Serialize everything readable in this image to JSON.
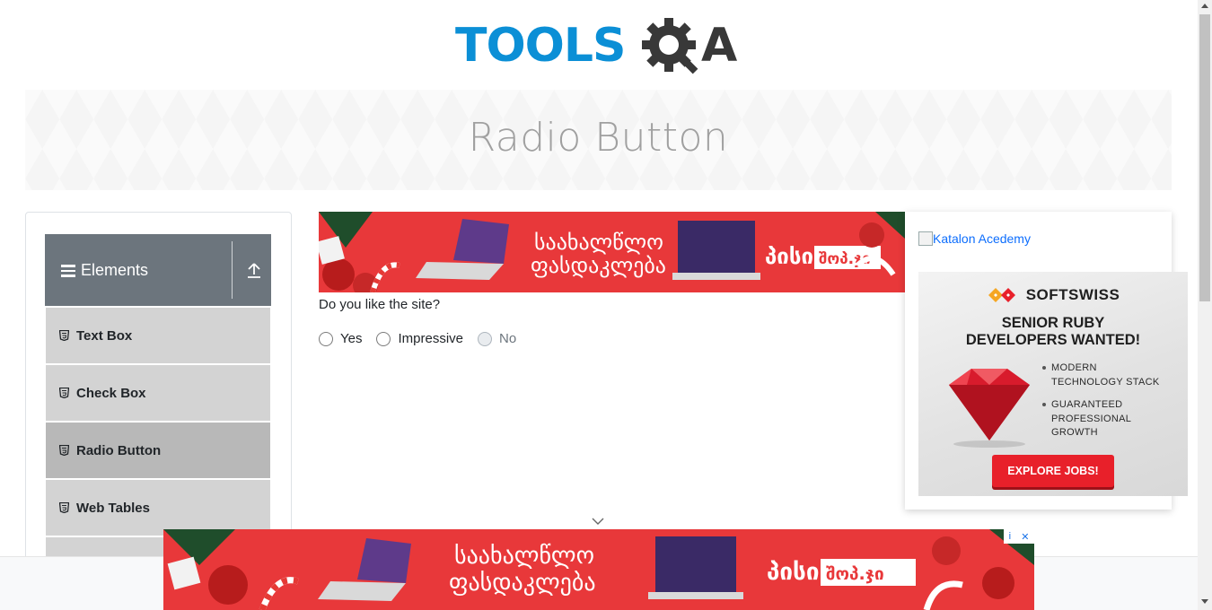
{
  "header": {
    "logo_text_tools": "TOOLS",
    "logo_text_a": "A",
    "logo_icon": "gear-magnifier-icon"
  },
  "banner": {
    "title": "Radio Button"
  },
  "sidebar": {
    "group_title": "Elements",
    "group_icon": "hamburger-icon",
    "collapse_icon": "upload-arrow-icon",
    "items": [
      {
        "label": "Text Box",
        "active": false
      },
      {
        "label": "Check Box",
        "active": false
      },
      {
        "label": "Radio Button",
        "active": true
      },
      {
        "label": "Web Tables",
        "active": false
      },
      {
        "label": "",
        "active": false
      }
    ]
  },
  "main": {
    "question": "Do you like the site?",
    "options": [
      {
        "label": "Yes",
        "disabled": false,
        "checked": false
      },
      {
        "label": "Impressive",
        "disabled": false,
        "checked": false
      },
      {
        "label": "No",
        "disabled": true,
        "checked": false
      }
    ]
  },
  "ads": {
    "top_banner": {
      "line1": "საახალწლო",
      "line2": "ფასდაკლება",
      "brand": "პისი",
      "brand_box": "შოპ.ჯი"
    },
    "bottom_banner": {
      "line1": "საახალწლო",
      "line2": "ფასდაკლება",
      "brand": "პისი",
      "brand_box": "შოპ.ჯი"
    },
    "katalon_alt": "Katalon Acedemy",
    "softswiss": {
      "brand": "SOFTSWISS",
      "headline_1": "SENIOR RUBY",
      "headline_2": "DEVELOPERS WANTED!",
      "bullet_1a": "MODERN",
      "bullet_1b": "TECHNOLOGY STACK",
      "bullet_2a": "GUARANTEED",
      "bullet_2b": "PROFESSIONAL",
      "bullet_2c": "GROWTH",
      "cta": "EXPLORE JOBS!"
    },
    "adchoices_info": "i",
    "adchoices_close": "✕"
  },
  "colors": {
    "logo_blue": "#0b8fd6",
    "logo_dark": "#383838",
    "sidebar_header": "#6c757d",
    "sidebar_item": "#d3d3d3",
    "sidebar_active": "#b8b8b8",
    "ad_red": "#e8383a",
    "cta_red": "#e8202a",
    "link_blue": "#0d6efd"
  }
}
